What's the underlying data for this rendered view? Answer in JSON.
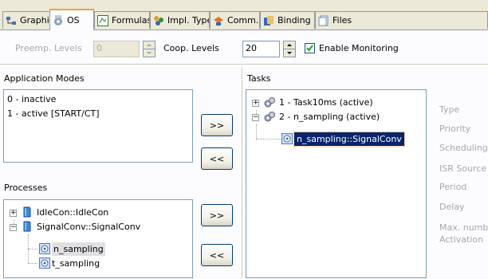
{
  "tabs": [
    {
      "label": "Graphics",
      "icon": "graphics-icon"
    },
    {
      "label": "OS",
      "icon": "os-icon"
    },
    {
      "label": "Formulas",
      "icon": "formulas-icon"
    },
    {
      "label": "Impl. Type",
      "icon": "impl-type-icon"
    },
    {
      "label": "Comm.",
      "icon": "comm-icon"
    },
    {
      "label": "Binding",
      "icon": "binding-icon"
    },
    {
      "label": "Files",
      "icon": "files-icon"
    }
  ],
  "active_tab": "OS",
  "toolbar": {
    "preemp_label": "Preemp. Levels",
    "preemp_value": "0",
    "coop_label": "Coop. Levels",
    "coop_value": "20",
    "monitoring_label": "Enable Monitoring",
    "monitoring_checked": true
  },
  "app_modes": {
    "title": "Application Modes",
    "items": [
      "0 - inactive",
      "1 - active [START/CT]"
    ]
  },
  "processes": {
    "title": "Processes",
    "items": [
      {
        "label": "IdleCon::IdleCon",
        "expander": "+"
      },
      {
        "label": "SignalConv::SignalConv",
        "expander": "−"
      },
      {
        "label": "n_sampling"
      },
      {
        "label": "t_sampling"
      }
    ]
  },
  "buttons": {
    "add": ">>",
    "remove": "<<"
  },
  "tasks": {
    "title": "Tasks",
    "items": [
      {
        "label": "1 - Task10ms (active)",
        "expander": "+"
      },
      {
        "label": "2 - n_sampling (active)",
        "expander": "−"
      },
      {
        "label": "n_sampling::SignalConv"
      }
    ]
  },
  "properties": {
    "labels": [
      "Type",
      "Priority",
      "Scheduling",
      "ISR Source",
      "Period",
      "Delay",
      "Max. numb",
      "Activation"
    ]
  },
  "colors": {
    "background": "#ece9d8",
    "selection": "#0a246a",
    "tab_highlight": "#f0a238",
    "disabled_text": "#a7a6aa",
    "panel_border": "#7f9db9"
  }
}
